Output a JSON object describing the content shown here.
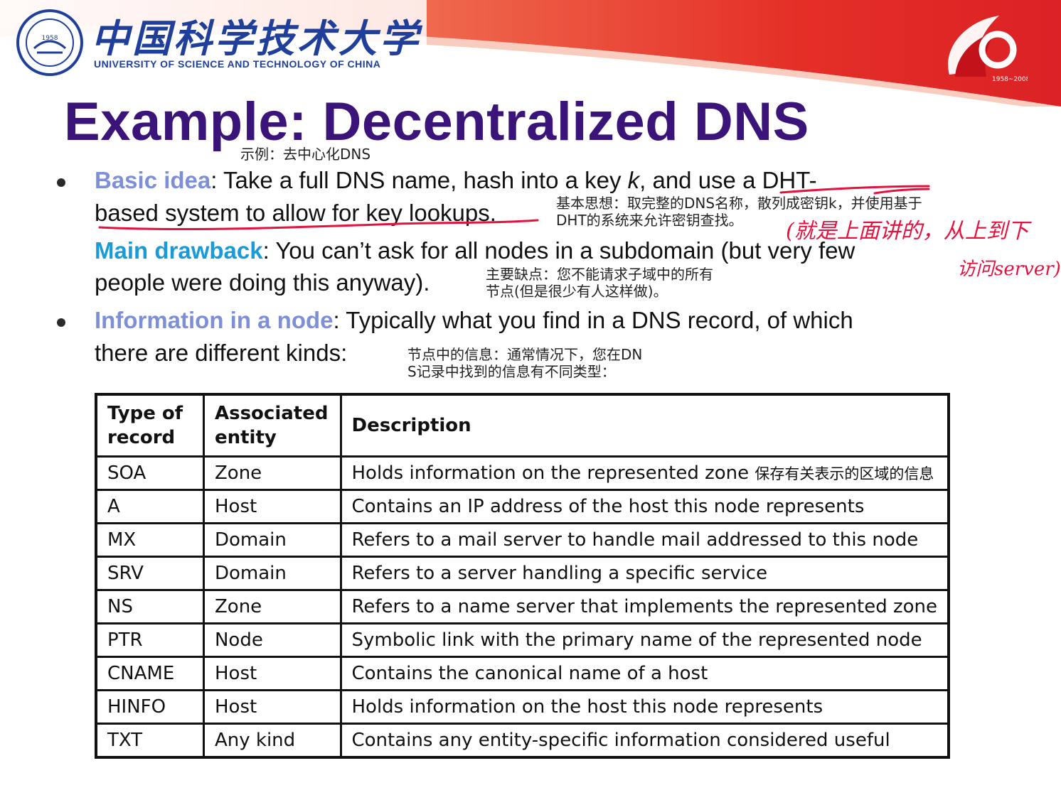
{
  "header": {
    "university_cn": "中国科学技术大学",
    "university_en": "UNIVERSITY OF SCIENCE AND TECHNOLOGY OF CHINA",
    "logo_year": "1958",
    "anniversary_years": "1958~2008",
    "colors": {
      "brand_blue": "#1f3f9a",
      "banner_red": "#e3241c"
    }
  },
  "slide": {
    "title": "Example: Decentralized DNS",
    "title_translation": "示例：去中心化DNS",
    "title_color": "#3a1478"
  },
  "bullets": [
    {
      "keyword": "Basic idea",
      "keyword_color": "#7d8fd6",
      "line1_a": ": Take a full DNS name, hash into a key ",
      "line1_k": "k",
      "line1_b": ", and use a DHT-",
      "line2": "based system to allow for key lookups.",
      "translation_line1": "基本思想：取完整的DNS名称，散列成密钥k，并使用基于",
      "translation_line2": "DHT的系统来允许密钥查找。",
      "sub_keyword": "Main drawback",
      "sub_keyword_color": "#1a9ad7",
      "sub_line1": ": You can’t ask for all nodes in a subdomain (but very few",
      "sub_line2": "people were doing this anyway).",
      "sub_translation_line1": "主要缺点：您不能请求子域中的所有",
      "sub_translation_line2": "节点(但是很少有人这样做)。"
    },
    {
      "keyword": "Information in a node",
      "keyword_color": "#7d8fd6",
      "line1": ": Typically what you find in a DNS record, of which",
      "line2": "there are different kinds:",
      "translation_line1": "节点中的信息：通常情况下，您在DN",
      "translation_line2": "S记录中找到的信息有不同类型："
    }
  ],
  "handwritten": {
    "line1": "(就是上面讲的，从上到下",
    "line2": "访问server)",
    "color": "#e3123f"
  },
  "table": {
    "headers": [
      "Type of record",
      "Associated entity",
      "Description"
    ],
    "rows": [
      [
        "SOA",
        "Zone",
        "Holds information on the represented zone"
      ],
      [
        "A",
        "Host",
        "Contains an IP address of the host this node represents"
      ],
      [
        "MX",
        "Domain",
        "Refers to a mail server to handle mail addressed to this node"
      ],
      [
        "SRV",
        "Domain",
        "Refers to a server handling a specific service"
      ],
      [
        "NS",
        "Zone",
        "Refers to a name server that implements the represented zone"
      ],
      [
        "PTR",
        "Node",
        "Symbolic link with the primary name of the represented node"
      ],
      [
        "CNAME",
        "Host",
        "Contains the canonical name of a host"
      ],
      [
        "HINFO",
        "Host",
        "Holds information on the host this node represents"
      ],
      [
        "TXT",
        "Any kind",
        "Contains any entity-specific information considered useful"
      ]
    ],
    "soa_note": "保存有关表示的区域的信息"
  }
}
